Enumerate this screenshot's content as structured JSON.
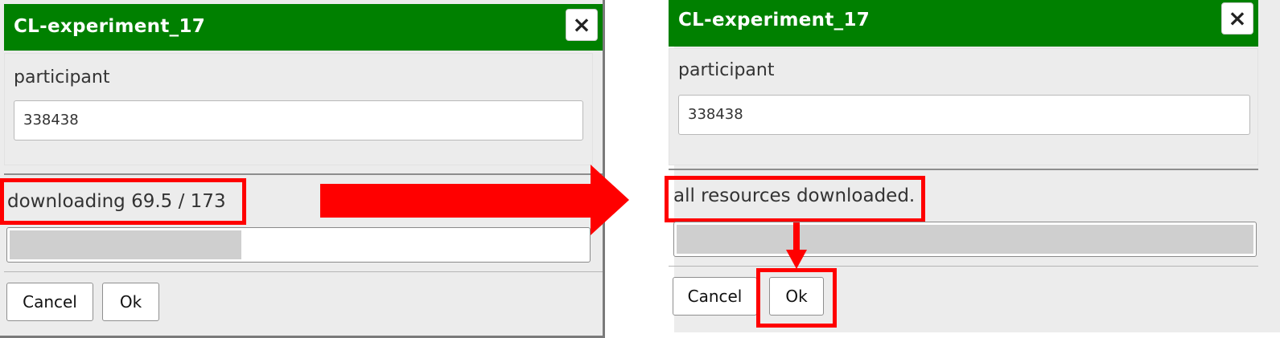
{
  "left_dialog": {
    "title": "CL-experiment_17",
    "close_icon": "×",
    "field_label": "participant",
    "field_value": "338438",
    "status": "downloading 69.5 / 173",
    "progress": {
      "current": 69.5,
      "total": 173
    },
    "cancel_label": "Cancel",
    "ok_label": "Ok"
  },
  "right_dialog": {
    "title": "CL-experiment_17",
    "close_icon": "×",
    "field_label": "participant",
    "field_value": "338438",
    "status": "all resources downloaded.",
    "progress": {
      "current": 173,
      "total": 173
    },
    "cancel_label": "Cancel",
    "ok_label": "Ok"
  },
  "colors": {
    "title_bar": "#008000",
    "highlight": "#ff0000",
    "progress_fill": "#cfcfcf"
  }
}
